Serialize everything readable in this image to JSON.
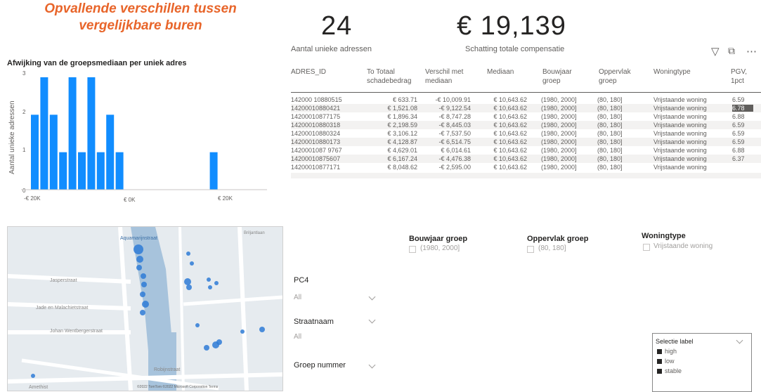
{
  "title": {
    "line1": "Opvallende verschillen tussen",
    "line2": "vergelijkbare buren"
  },
  "kpis": [
    {
      "value": "24",
      "label": "Aantal unieke adressen"
    },
    {
      "value": "€ 19,139",
      "label": "Schatting totale compensatie"
    }
  ],
  "chart": {
    "title": "Afwijking van de groepsmediaan per uniek adres",
    "ylabel": "Aantal unieke adressen",
    "y_ticks": [
      "0",
      "1",
      "2",
      "3"
    ],
    "x_ticks": [
      "-€ 20K",
      "€ 0K",
      "€ 20K"
    ]
  },
  "chart_data": {
    "type": "bar",
    "title": "Afwijking van de groepsmediaan per uniek adres",
    "xlabel": "",
    "ylabel": "Aantal unieke adressen",
    "ylim": [
      0,
      3
    ],
    "grid": false,
    "legend": "none",
    "values": [
      2,
      3,
      2,
      1,
      3,
      1,
      3,
      1,
      2,
      1,
      0,
      0,
      0,
      0,
      0,
      0,
      0,
      0,
      0,
      1
    ],
    "color": "#118dff"
  },
  "table": {
    "headers": [
      "ADRES_ID",
      "To Totaal schadebedrag",
      "Verschil met mediaan",
      "Mediaan",
      "Bouwjaar groep",
      "Oppervlak groep",
      "Woningtype",
      "PGV, 1pct"
    ],
    "rows": [
      [
        "142000 10880515",
        "€ 633.71",
        "-€ 10,009.91",
        "€ 10,643.62",
        "(1980, 2000]",
        "(80, 180]",
        "Vrijstaande woning",
        "6.59"
      ],
      [
        "14200010880421",
        "€ 1,521.08",
        "-€ 9,122.54",
        "€ 10,643.62",
        "(1980, 2000]",
        "(80, 180]",
        "Vrijstaande woning",
        "6.78"
      ],
      [
        "14200010877175",
        "€ 1,896.34",
        "-€ 8,747.28",
        "€ 10,643.62",
        "(1980, 2000]",
        "(80, 180]",
        "Vrijstaande woning",
        "6.88"
      ],
      [
        "14200010880318",
        "€ 2,198.59",
        "-€ 8,445.03",
        "€ 10,643.62",
        "(1980, 2000]",
        "(80, 180]",
        "Vrijstaande woning",
        "6.59"
      ],
      [
        "14200010880324",
        "€ 3,106.12",
        "-€ 7,537.50",
        "€ 10,643.62",
        "(1980, 2000]",
        "(80, 180]",
        "Vrijstaande woning",
        "6.59"
      ],
      [
        "14200010880173",
        "€ 4,128.87",
        "-€ 6,514.75",
        "€ 10,643.62",
        "(1980, 2000]",
        "(80, 180]",
        "Vrijstaande woning",
        "6.59"
      ],
      [
        "1420001087 9767",
        "€ 4,629.01",
        "€ 6,014.61",
        "€ 10,643.62",
        "(1980, 2000]",
        "(80, 180]",
        "Vrijstaande woning",
        "6.88"
      ],
      [
        "14200010875607",
        "€ 6,167.24",
        "-€ 4,476.38",
        "€ 10,643.62",
        "(1980, 2000]",
        "(80, 180]",
        "Vrijstaande woning",
        "6.37"
      ],
      [
        "14200010877171",
        "€ 8,048.62",
        "-€ 2,595.00",
        "€ 10,643.62",
        "(1980, 2000]",
        "(80, 180]",
        "Vrijstaande woning",
        ""
      ]
    ]
  },
  "slicers": {
    "bouwjaar": {
      "title": "Bouwjaar groep",
      "value": "(1980, 2000]"
    },
    "oppervlak": {
      "title": "Oppervlak groep",
      "value": "(80, 180]"
    },
    "woningtype": {
      "title": "Woningtype",
      "value": "Vrijstaande woning"
    },
    "pc4": {
      "title": "PC4",
      "value": "All"
    },
    "straatnaam": {
      "title": "Straatnaam",
      "value": "All"
    },
    "groep": {
      "title": "Groep nummer"
    }
  },
  "map": {
    "streets": [
      "Aquamarijnstraat",
      "Jasperstraat",
      "Jade en Malachietstraat",
      "Johan Wentbergerstraat",
      "Robijnstraat",
      "Briljantlaan",
      "Amethist"
    ],
    "attribution": "©2022 TomTom ©2022 Microsoft Corporation Terms"
  },
  "legend": {
    "title": "Selectie label",
    "items": [
      "high",
      "low",
      "stable"
    ]
  },
  "colors": {
    "accent": "#e8652a",
    "bar": "#118dff",
    "map_water": "#a7c3dc",
    "map_land": "#e6ebef",
    "dot": "#2e7bd6"
  }
}
